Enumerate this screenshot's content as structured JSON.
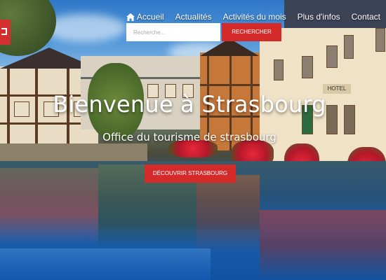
{
  "nav": {
    "items": [
      {
        "label": "Accueil",
        "icon": "home-icon"
      },
      {
        "label": "Actualités"
      },
      {
        "label": "Activités du mois"
      },
      {
        "label": "Plus d'infos"
      },
      {
        "label": "Contact"
      }
    ]
  },
  "search": {
    "placeholder": "Recherche...",
    "button_label": "RECHERCHER"
  },
  "hero": {
    "title": "Bienvenue à Strasbourg",
    "subtitle": "Office du tourisme de strasbourg",
    "cta_label": "DÉCOUVRIR STRASBOURG",
    "hotel_sign": "HOTEL"
  },
  "colors": {
    "accent": "#d42a2a",
    "text": "#ffffff"
  }
}
